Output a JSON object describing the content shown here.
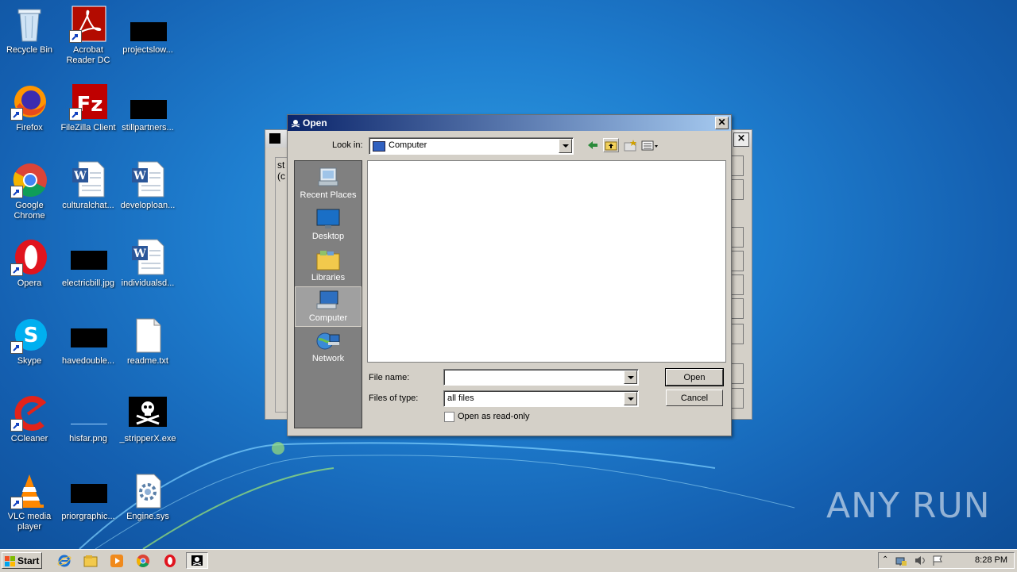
{
  "desktop": {
    "icons": [
      {
        "label": "Recycle Bin"
      },
      {
        "label": "Acrobat Reader DC"
      },
      {
        "label": "projectslow..."
      },
      {
        "label": "Firefox"
      },
      {
        "label": "FileZilla Client"
      },
      {
        "label": "stillpartners..."
      },
      {
        "label": "Google Chrome"
      },
      {
        "label": "culturalchat..."
      },
      {
        "label": "developloan..."
      },
      {
        "label": "Opera"
      },
      {
        "label": "electricbill.jpg"
      },
      {
        "label": "individualsd..."
      },
      {
        "label": "Skype"
      },
      {
        "label": "havedouble..."
      },
      {
        "label": "readme.txt"
      },
      {
        "label": "CCleaner"
      },
      {
        "label": "hisfar.png"
      },
      {
        "label": "_stripperX.exe"
      },
      {
        "label": "VLC media player"
      },
      {
        "label": "priorgraphic..."
      },
      {
        "label": "Engine.sys"
      }
    ]
  },
  "background_window": {
    "partial_text_line1": "st",
    "partial_text_line2": "(c"
  },
  "open_dialog": {
    "title": "Open",
    "look_in_label": "Look in:",
    "look_in_value": "Computer",
    "places": [
      {
        "label": "Recent Places"
      },
      {
        "label": "Desktop"
      },
      {
        "label": "Libraries"
      },
      {
        "label": "Computer",
        "selected": true
      },
      {
        "label": "Network"
      }
    ],
    "file_name_label": "File name:",
    "file_name_value": "",
    "files_of_type_label": "Files of type:",
    "files_of_type_value": "all files",
    "read_only_label": "Open as read-only",
    "read_only_checked": false,
    "open_button": "Open",
    "cancel_button": "Cancel"
  },
  "taskbar": {
    "start_label": "Start",
    "clock": "8:28 PM"
  },
  "watermark": "ANY RUN"
}
